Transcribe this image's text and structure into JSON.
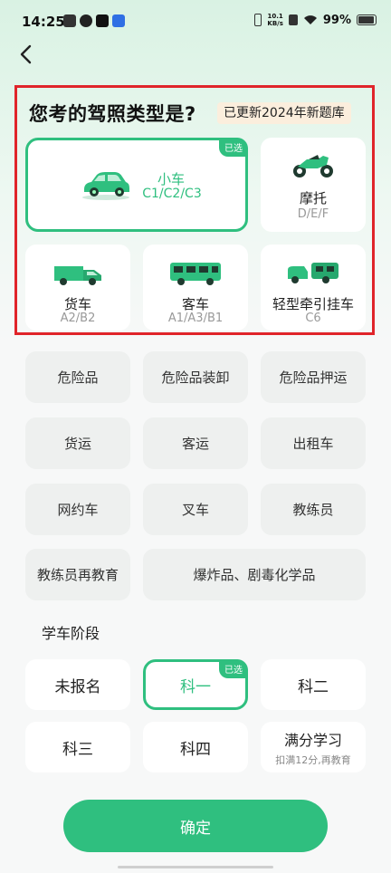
{
  "status": {
    "time": "14:25",
    "speed_value": "10.1",
    "speed_unit": "KB/s",
    "battery": "99%"
  },
  "header": {
    "title": "您考的驾照类型是?",
    "badge": "已更新2024年新题库"
  },
  "selected_tag": "已选",
  "vehicle_types": [
    {
      "name": "小车",
      "sub": "C1/C2/C3",
      "selected": true
    },
    {
      "name": "摩托",
      "sub": "D/E/F"
    },
    {
      "name": "货车",
      "sub": "A2/B2"
    },
    {
      "name": "客车",
      "sub": "A1/A3/B1"
    },
    {
      "name": "轻型牵引挂车",
      "sub": "C6"
    }
  ],
  "other_types": [
    "危险品",
    "危险品装卸",
    "危险品押运",
    "货运",
    "客运",
    "出租车",
    "网约车",
    "叉车",
    "教练员",
    "教练员再教育",
    "爆炸品、剧毒化学品"
  ],
  "stage_section": {
    "title": "学车阶段"
  },
  "stages": [
    {
      "name": "未报名"
    },
    {
      "name": "科一",
      "selected": true
    },
    {
      "name": "科二"
    },
    {
      "name": "科三"
    },
    {
      "name": "科四"
    },
    {
      "name": "满分学习",
      "note": "扣满12分,再教育"
    }
  ],
  "confirm_label": "确定",
  "colors": {
    "accent": "#2fbf7f",
    "highlight_box": "#e0242a",
    "badge_bg": "#fbeedd"
  }
}
